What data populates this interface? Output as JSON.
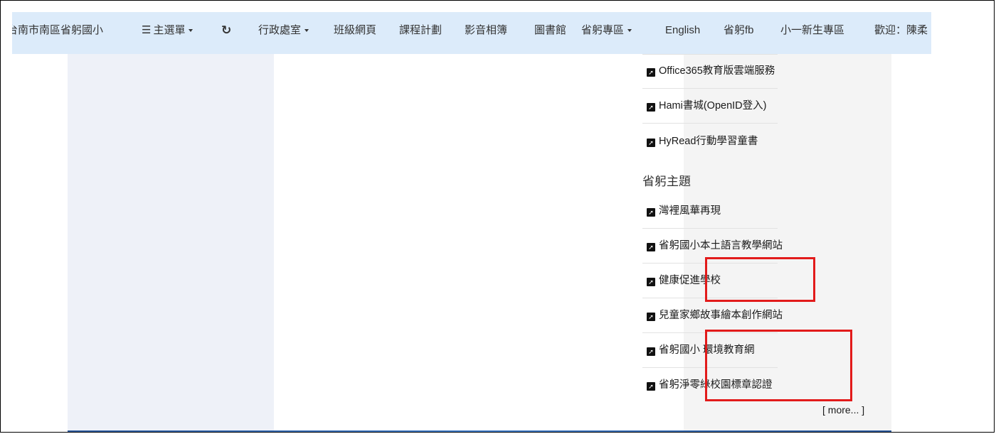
{
  "navbar": {
    "site_name": "台南市南區省躬國小",
    "main_menu": "主選單",
    "refresh_icon": "refresh-icon",
    "admin": "行政處室",
    "class_pages": "班級網頁",
    "curriculum": "課程計劃",
    "album": "影音相簿",
    "library": "圖書館",
    "special": "省躬專區",
    "english": "English",
    "fb": "省躬fb",
    "freshman": "小一新生專區",
    "welcome": "歡迎：陳柔"
  },
  "sidebar": {
    "links_top": [
      {
        "label": "Office365教育版雲端服務"
      },
      {
        "label": "Hami書城(OpenID登入)"
      },
      {
        "label": "HyRead行動學習童書"
      }
    ],
    "section_title": "省躬主題",
    "theme_links": [
      {
        "label": "灣裡風華再現"
      },
      {
        "label": "省躬國小本土語言教學網站"
      },
      {
        "label": "健康促進學校"
      },
      {
        "label": "兒童家鄉故事繪本創作網站"
      },
      {
        "label": "省躬國小 環境教育網"
      },
      {
        "label": "省躬淨零綠校園標章認證"
      }
    ],
    "more": "[ more... ]"
  },
  "colors": {
    "navbar_bg": "#dcebfa",
    "highlight": "#e21b1b",
    "footer_bar": "#2d5a9c"
  }
}
